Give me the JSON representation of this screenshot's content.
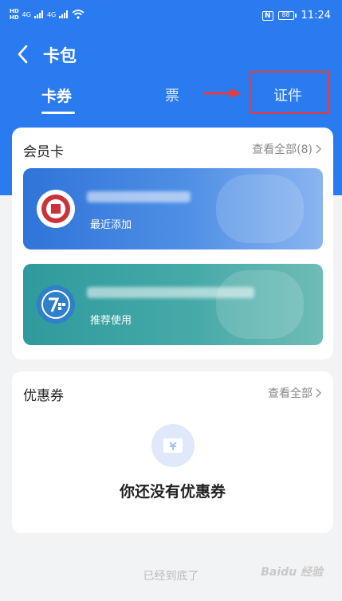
{
  "status_bar": {
    "left_tags": [
      "HD",
      "HD"
    ],
    "network_labels": [
      "4G",
      "4G"
    ],
    "nfc": "N",
    "battery": "88",
    "time": "11:24"
  },
  "header": {
    "title": "卡包"
  },
  "tabs": [
    {
      "label": "卡券",
      "active": true
    },
    {
      "label": "票",
      "active": false
    },
    {
      "label": "证件",
      "active": false
    }
  ],
  "member_cards": {
    "title": "会员卡",
    "view_all": "查看全部(8)",
    "cards": [
      {
        "subtitle": "最近添加",
        "color": "#2f74d8"
      },
      {
        "subtitle": "推荐使用",
        "color": "#2f9a9c"
      }
    ]
  },
  "coupons": {
    "title": "优惠券",
    "view_all": "查看全部",
    "empty_text": "你还没有优惠券"
  },
  "footer": {
    "end_text": "已经到底了",
    "watermark": "Baidu 经验"
  },
  "colors": {
    "accent": "#2b7bf0",
    "highlight_box": "#e83b3b"
  }
}
